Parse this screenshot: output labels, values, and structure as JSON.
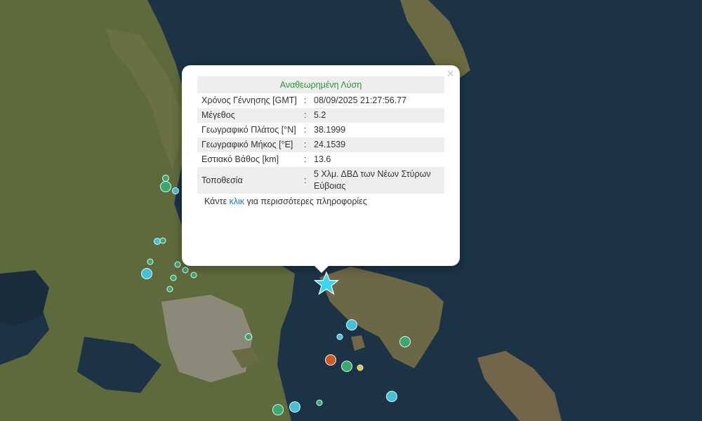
{
  "popup": {
    "title": "Αναθεωρημένη Λύση",
    "close_symbol": "×",
    "rows": [
      {
        "label": "Χρόνος Γέννησης [GMT]",
        "sep": ":",
        "value": "08/09/2025 21:27:56.77"
      },
      {
        "label": "Μέγεθος",
        "sep": ":",
        "value": "5.2"
      },
      {
        "label": "Γεωγραφικό Πλάτος [°N]",
        "sep": ":",
        "value": "38.1999"
      },
      {
        "label": "Γεωγραφικό Μήκος [°E]",
        "sep": ":",
        "value": "24.1539"
      },
      {
        "label": "Εστιακό Βάθος [km]",
        "sep": ":",
        "value": "13.6"
      },
      {
        "label": "Τοποθεσία",
        "sep": ":",
        "value": "5 Χλμ. ΔΒΔ των Νέων Στύρων Εύβοιας"
      }
    ],
    "footer": {
      "before": "Κάντε ",
      "link": "κλικ",
      "after": " για περισσότερες πληροφορίες"
    }
  },
  "colors": {
    "sea": "#1c3346",
    "land": "#5f6a3c",
    "title_green": "#2f8f3a",
    "link_blue": "#1a73c9",
    "marker_green": "#37a96a",
    "marker_cyan": "#42c1d7",
    "marker_orange": "#cf5b1e",
    "marker_yellow": "#e7c12b",
    "epicenter_star": "#38d6f2"
  },
  "icons": {
    "epicenter": "star-icon",
    "close": "close-icon"
  }
}
